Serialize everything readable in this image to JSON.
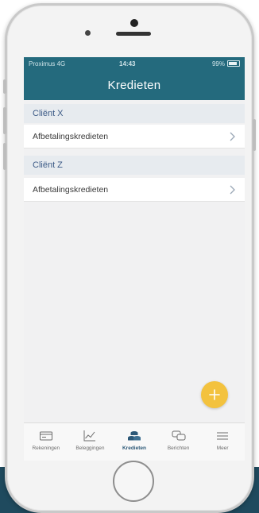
{
  "status_bar": {
    "carrier": "Proximus 4G",
    "time": "14:43",
    "battery": "99%"
  },
  "nav": {
    "title": "Kredieten"
  },
  "sections": [
    {
      "header": "Cliënt X",
      "items": [
        {
          "label": "Afbetalingskredieten"
        }
      ]
    },
    {
      "header": "Cliënt Z",
      "items": [
        {
          "label": "Afbetalingskredieten"
        }
      ]
    }
  ],
  "fab": {
    "icon": "plus-icon",
    "color": "#f3c23e"
  },
  "tabs": [
    {
      "label": "Rekeningen",
      "icon": "card-icon",
      "active": false
    },
    {
      "label": "Beleggingen",
      "icon": "chart-line-icon",
      "active": false
    },
    {
      "label": "Kredieten",
      "icon": "coins-stack-icon",
      "active": true
    },
    {
      "label": "Berichten",
      "icon": "chat-bubbles-icon",
      "active": false
    },
    {
      "label": "Meer",
      "icon": "menu-icon",
      "active": false
    }
  ],
  "colors": {
    "header": "#246a7d",
    "section_header_bg": "#e7ebef",
    "section_header_text": "#3c5a86",
    "active_tab": "#2c5877"
  }
}
